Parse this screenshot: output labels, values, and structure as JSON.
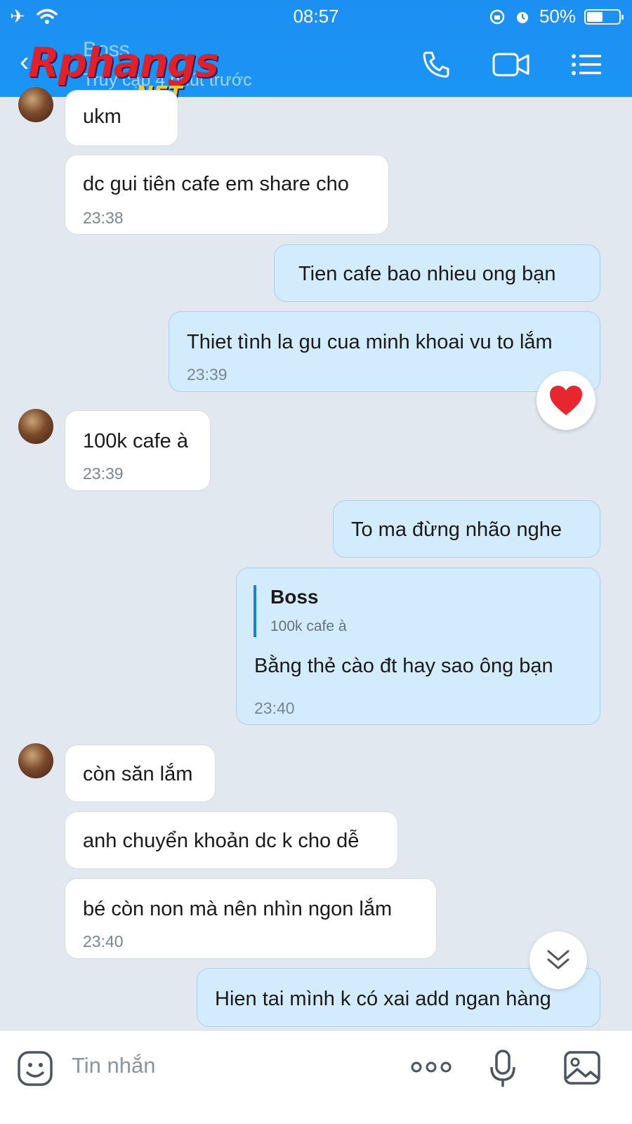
{
  "status_bar": {
    "time": "08:57",
    "battery": "50%"
  },
  "header": {
    "contact_name": "Boss",
    "presence": "Truy cập 4 phút trước",
    "watermark_logo": "Rphangs",
    "watermark_suffix": ".NET"
  },
  "messages": [
    {
      "direction": "in",
      "text": "ukm"
    },
    {
      "direction": "in",
      "text": "dc gui tiên cafe em share cho",
      "time": "23:38"
    },
    {
      "direction": "out",
      "text": "Tien cafe bao nhieu ong bạn"
    },
    {
      "direction": "out",
      "text": "Thiet tình la gu cua minh khoai vu to lắm",
      "time": "23:39",
      "reaction": "heart"
    },
    {
      "direction": "in",
      "text": "100k cafe à",
      "time": "23:39"
    },
    {
      "direction": "out",
      "text": "To ma đừng nhão nghe"
    },
    {
      "direction": "out",
      "reply_to": {
        "name": "Boss",
        "text": "100k cafe à"
      },
      "text": "Bằng thẻ cào đt hay sao ông bạn",
      "time": "23:40"
    },
    {
      "direction": "in",
      "text": "còn săn lắm"
    },
    {
      "direction": "in",
      "text": "anh chuyển khoản dc k cho dễ"
    },
    {
      "direction": "in",
      "text": "bé còn non mà nên nhìn ngon lắm",
      "time": "23:40"
    },
    {
      "direction": "out",
      "text": "Hien tai mình k có xai add ngan hàng"
    }
  ],
  "composer": {
    "placeholder": "Tin nhắn"
  },
  "colors": {
    "header": "#1a95f5",
    "incoming_bubble": "#ffffff",
    "outgoing_bubble": "#d3ecfd",
    "background": "#e2e8f0"
  }
}
